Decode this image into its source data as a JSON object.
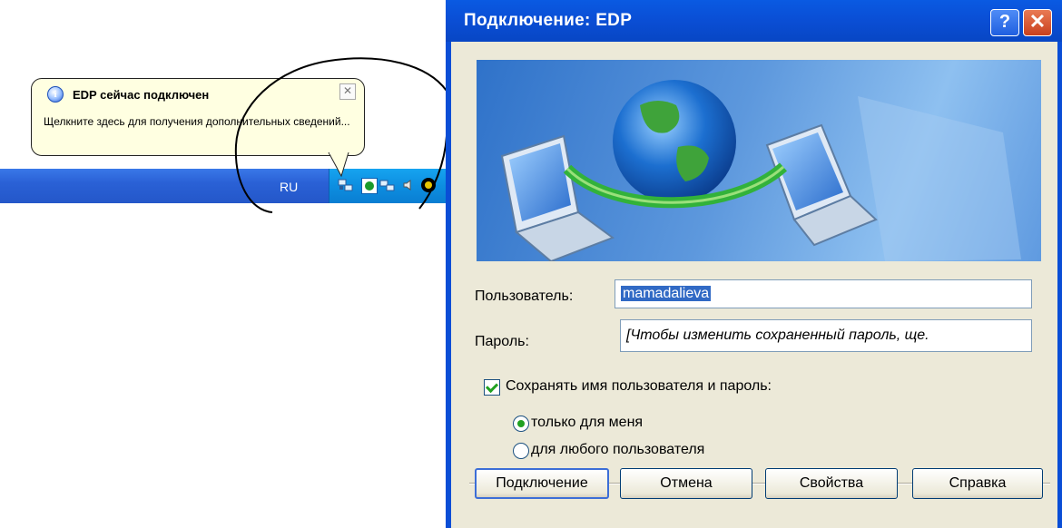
{
  "taskbar": {
    "language": "RU"
  },
  "balloon": {
    "title": "EDP сейчас подключен",
    "message": "Щелкните здесь для получения дополнительных сведений...",
    "close_glyph": "✕"
  },
  "dialog": {
    "title": "Подключение: EDP",
    "help_glyph": "?",
    "close_glyph": "✕",
    "user_label": "Пользователь:",
    "user_value": "mamadalieva",
    "password_label": "Пароль:",
    "password_value": "[Чтобы изменить сохраненный пароль, ще.",
    "save_checkbox_label": "Сохранять имя пользователя и пароль:",
    "save_checked": true,
    "radio_only_me": "только для меня",
    "radio_any_user": "для любого пользователя",
    "radio_selected": "only_me",
    "buttons": {
      "connect": "Подключение",
      "cancel": "Отмена",
      "properties": "Свойства",
      "help": "Справка"
    }
  },
  "colors": {
    "xp_title_blue": "#0a4fd6",
    "dialog_face": "#ece9d8",
    "balloon_bg": "#ffffe1",
    "selection": "#316ac5",
    "check_green": "#21a121"
  }
}
